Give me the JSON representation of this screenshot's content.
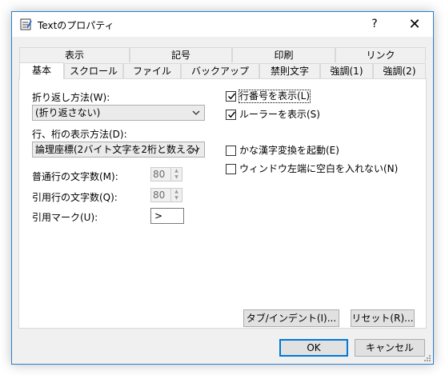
{
  "window": {
    "title": "Textのプロパティ",
    "help_label": "?",
    "close_label": "✕"
  },
  "tabs": {
    "row1": [
      "表示",
      "記号",
      "印刷",
      "リンク"
    ],
    "row2": [
      "基本",
      "スクロール",
      "ファイル",
      "バックアップ",
      "禁則文字",
      "強調(1)",
      "強調(2)"
    ]
  },
  "panel": {
    "wrap_label": "折り返し方法(W):",
    "wrap_value": "(折り返さない)",
    "coord_label": "行、桁の表示方法(D):",
    "coord_value": "論理座標(2バイト文字を2桁と数える)",
    "normal_width_label": "普通行の文字数(M):",
    "normal_width_value": "80",
    "quote_width_label": "引用行の文字数(Q):",
    "quote_width_value": "80",
    "quote_mark_label": "引用マーク(U):",
    "quote_mark_value": ">",
    "checkboxes": [
      {
        "label": "行番号を表示(L)",
        "checked": true
      },
      {
        "label": "ルーラーを表示(S)",
        "checked": true
      },
      {
        "label": "かな漢字変換を起動(E)",
        "checked": false
      },
      {
        "label": "ウィンドウ左端に空白を入れない(N)",
        "checked": false
      }
    ],
    "tab_indent_button": "タブ/インデント(I)...",
    "reset_button": "リセット(R)..."
  },
  "footer": {
    "ok": "OK",
    "cancel": "キャンセル"
  },
  "icons": {
    "app": "notepad-icon",
    "dropdown": "chevron-down-icon",
    "check": "check-icon",
    "grip": "resize-grip-icon"
  },
  "colors": {
    "accent": "#0078d7",
    "window_border": "#2b7ed1",
    "face": "#f0f0f0"
  }
}
